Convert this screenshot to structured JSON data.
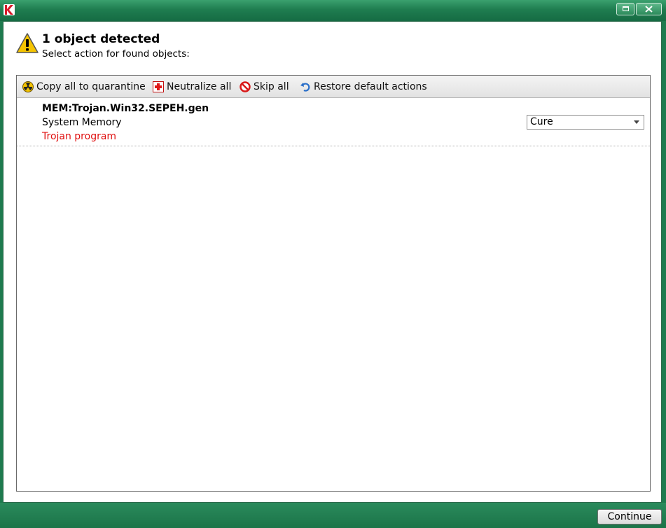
{
  "window": {
    "logo_icon": "kaspersky-k-icon",
    "maximize_icon": "maximize-icon",
    "close_icon": "close-icon"
  },
  "header": {
    "icon": "warning-icon",
    "title": "1 object detected",
    "subtitle": "Select action for found objects:"
  },
  "toolbar": {
    "items": [
      {
        "label": "Copy all to quarantine",
        "icon": "radiation-icon"
      },
      {
        "label": "Neutralize all",
        "icon": "red-cross-icon"
      },
      {
        "label": "Skip all",
        "icon": "prohibited-icon"
      },
      {
        "label": "Restore default actions",
        "icon": "undo-arrow-icon"
      }
    ]
  },
  "objects": [
    {
      "name": "MEM:Trojan.Win32.SEPEH.gen",
      "location": "System Memory",
      "type": "Trojan program",
      "action": "Cure"
    }
  ],
  "footer": {
    "continue_label": "Continue"
  },
  "colors": {
    "frame": "#1e7a4e",
    "threat_type": "#e01010"
  }
}
